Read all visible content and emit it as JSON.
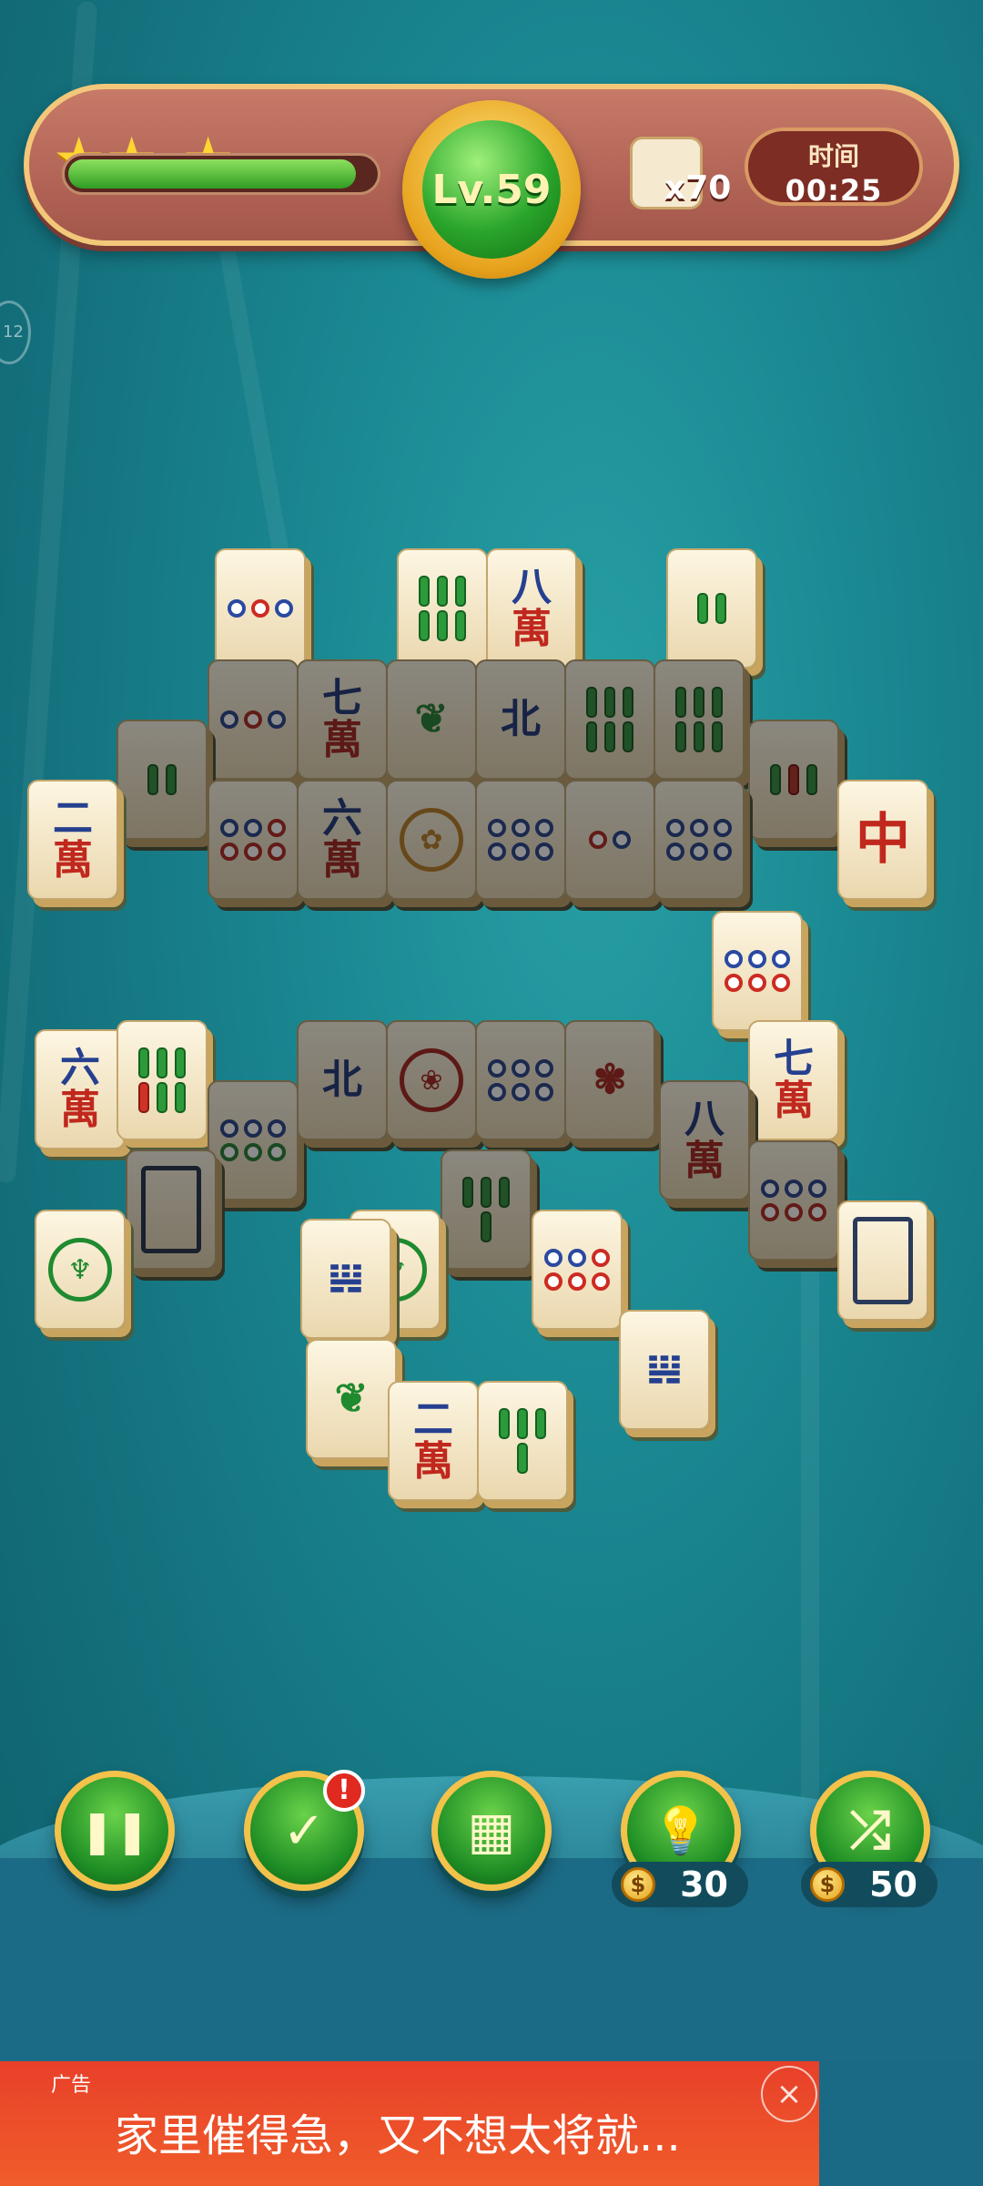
{
  "hud": {
    "stars": [
      "★",
      "★",
      "★"
    ],
    "progress_fraction": 0.94,
    "level_label": "Lv.59",
    "tile_count_label": "x70",
    "timer_label": "时间",
    "timer_value": "00:25"
  },
  "side_bubble_label": "12",
  "tiles": [
    {
      "id": "t1",
      "text": "",
      "kind": "dots3"
    },
    {
      "id": "t2",
      "text": "",
      "kind": "bamboo6"
    },
    {
      "id": "t3",
      "top": "八",
      "bottom": "萬",
      "kind": "char"
    },
    {
      "id": "t4",
      "text": "",
      "kind": "bamboo2"
    },
    {
      "id": "t5",
      "top": "七",
      "bottom": "萬",
      "kind": "char"
    },
    {
      "id": "t6",
      "text": "北",
      "kind": "wind"
    },
    {
      "id": "t7",
      "top": "二",
      "bottom": "萬",
      "kind": "char"
    },
    {
      "id": "t8",
      "top": "六",
      "bottom": "萬",
      "kind": "char"
    },
    {
      "id": "t9",
      "text": "中",
      "kind": "dragon"
    },
    {
      "id": "t10",
      "top": "六",
      "bottom": "萬",
      "kind": "char"
    },
    {
      "id": "t11",
      "text": "北",
      "kind": "wind"
    },
    {
      "id": "t12",
      "top": "七",
      "bottom": "萬",
      "kind": "char"
    },
    {
      "id": "t13",
      "top": "八",
      "bottom": "萬",
      "kind": "char"
    },
    {
      "id": "t14",
      "top": "二",
      "bottom": "萬",
      "kind": "char"
    }
  ],
  "buttons": {
    "pause_glyph": "❚❚",
    "daily_glyph": "✓",
    "notify_badge": "!",
    "calendar_glyph": "▦",
    "hint_glyph": "💡",
    "shuffle_glyph": "⤮",
    "hint_cost": "30",
    "shuffle_cost": "50",
    "coin_glyph": "$"
  },
  "ad": {
    "tag": "广告",
    "text": "家里催得急，又不想太将就...",
    "close_glyph": "×"
  },
  "colors": {
    "background": "#1b7f8a",
    "hud_panel": "#b4665a",
    "accent_gold": "#f3c24a",
    "button_green": "#1f8e25",
    "ad_red": "#e8402a"
  }
}
